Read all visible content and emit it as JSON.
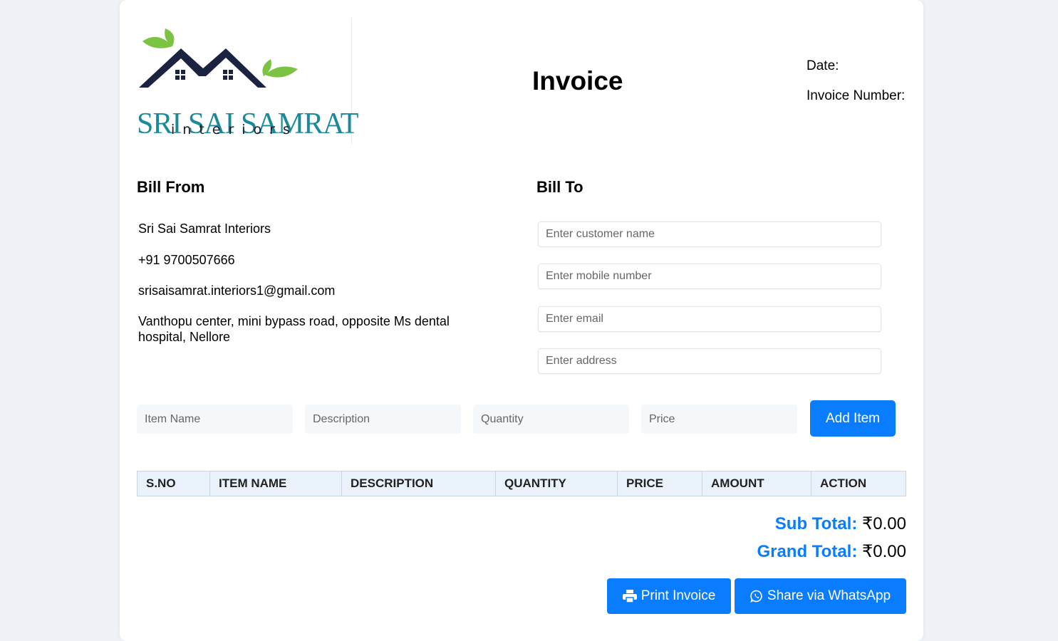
{
  "brand": {
    "name": "SRI SAI SAMRAT",
    "tagline": "interiors",
    "colors": {
      "teal": "#1a8a9a",
      "navy": "#1c2340",
      "leaf": "#7cc243"
    }
  },
  "header": {
    "title": "Invoice",
    "date_label": "Date:",
    "invoice_number_label": "Invoice Number:"
  },
  "bill_from": {
    "heading": "Bill From",
    "company": "Sri Sai Samrat Interiors",
    "phone": "+91 9700507666",
    "email": "srisaisamrat.interiors1@gmail.com",
    "address": "Vanthopu center, mini bypass road, opposite Ms dental hospital, Nellore"
  },
  "bill_to": {
    "heading": "Bill To",
    "customer_placeholder": "Enter customer name",
    "mobile_placeholder": "Enter mobile number",
    "email_placeholder": "Enter email",
    "address_placeholder": "Enter address"
  },
  "item_form": {
    "name_placeholder": "Item Name",
    "description_placeholder": "Description",
    "quantity_placeholder": "Quantity",
    "price_placeholder": "Price",
    "add_label": "Add Item"
  },
  "table": {
    "columns": [
      "S.NO",
      "ITEM NAME",
      "DESCRIPTION",
      "QUANTITY",
      "PRICE",
      "AMOUNT",
      "ACTION"
    ]
  },
  "totals": {
    "subtotal_label": "Sub Total:",
    "subtotal_value": "₹0.00",
    "grand_label": "Grand Total:",
    "grand_value": "₹0.00"
  },
  "actions": {
    "print_label": "Print Invoice",
    "print_icon": "printer-icon",
    "share_label": "Share via WhatsApp",
    "share_icon": "whatsapp-icon"
  },
  "accent_color": "#0a7cff"
}
